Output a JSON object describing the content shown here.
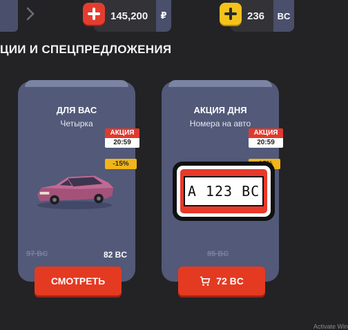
{
  "topbar": {
    "rubles": {
      "amount": "145,200",
      "unit": "₽"
    },
    "bc": {
      "amount": "236",
      "unit": "BC"
    }
  },
  "section": {
    "title": "ЦИИ И СПЕЦПРЕДЛОЖЕНИЯ"
  },
  "cards": [
    {
      "title": "ДЛЯ ВАС",
      "subtitle": "Четырка",
      "promo_label": "АКЦИЯ",
      "timer": "20:59",
      "discount": "-15%",
      "old_price": "97 BC",
      "new_price": "82 BC",
      "button_label": "СМОТРЕТЬ",
      "image": "car-image"
    },
    {
      "title": "АКЦИЯ ДНЯ",
      "subtitle": "Номера на авто",
      "promo_label": "АКЦИЯ",
      "timer": "20:59",
      "discount": "-15%",
      "old_price": "85 BC",
      "button_price": "72 BC",
      "plate_text": "A 123 BC",
      "image": "license-plate-image",
      "button_icon": "cart-icon"
    }
  ],
  "watermark": "Activate Win",
  "colors": {
    "accent_red": "#e43a22",
    "accent_yellow": "#f4c21b",
    "card_bg": "#525979",
    "background": "#232325"
  }
}
